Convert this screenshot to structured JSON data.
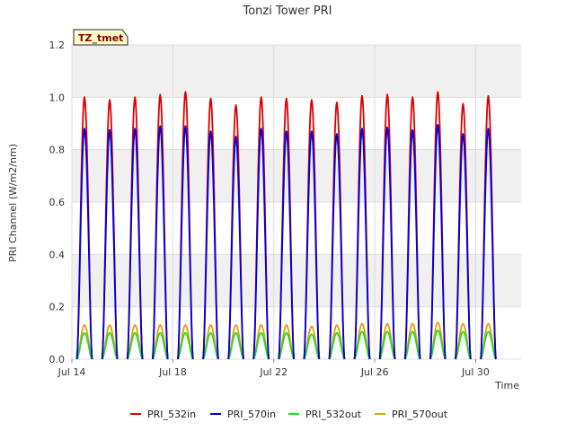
{
  "chart_data": {
    "type": "line",
    "title": "Tonzi Tower PRI",
    "badge": "TZ_tmet",
    "xlabel": "Time",
    "ylabel": "PRI Channel (W/m2/nm)",
    "x_ticks": [
      "Jul 14",
      "Jul 18",
      "Jul 22",
      "Jul 26",
      "Jul 30"
    ],
    "x_tick_days": [
      14,
      18,
      22,
      26,
      30
    ],
    "xlim": [
      14,
      31.8
    ],
    "ylim": [
      0,
      1.2
    ],
    "y_ticks": [
      "0.0",
      "0.2",
      "0.4",
      "0.6",
      "0.8",
      "1.0",
      "1.2"
    ],
    "y_tick_values": [
      0,
      0.2,
      0.4,
      0.6,
      0.8,
      1.0,
      1.2
    ],
    "grid": true,
    "legend_position": "bottom",
    "peak_time_of_day": 0.5,
    "series": [
      {
        "name": "PRI_532in",
        "color": "#dd0000",
        "days": [
          14.5,
          15.5,
          16.5,
          17.5,
          18.5,
          19.5,
          20.5,
          21.5,
          22.5,
          23.5,
          24.5,
          25.5,
          26.5,
          27.5,
          28.5,
          29.5,
          30.5
        ],
        "peaks": [
          1.0,
          0.99,
          1.0,
          1.01,
          1.02,
          0.995,
          0.97,
          1.0,
          0.995,
          0.99,
          0.98,
          1.005,
          1.01,
          1.0,
          1.02,
          0.975,
          1.005
        ]
      },
      {
        "name": "PRI_570in",
        "color": "#0000dd",
        "days": [
          14.5,
          15.5,
          16.5,
          17.5,
          18.5,
          19.5,
          20.5,
          21.5,
          22.5,
          23.5,
          24.5,
          25.5,
          26.5,
          27.5,
          28.5,
          29.5,
          30.5
        ],
        "peaks": [
          0.88,
          0.875,
          0.88,
          0.89,
          0.89,
          0.87,
          0.85,
          0.88,
          0.87,
          0.87,
          0.86,
          0.88,
          0.885,
          0.875,
          0.895,
          0.86,
          0.88
        ]
      },
      {
        "name": "PRI_532out",
        "color": "#22dd22",
        "days": [
          14.5,
          15.5,
          16.5,
          17.5,
          18.5,
          19.5,
          20.5,
          21.5,
          22.5,
          23.5,
          24.5,
          25.5,
          26.5,
          27.5,
          28.5,
          29.5,
          30.5
        ],
        "peaks": [
          0.1,
          0.1,
          0.1,
          0.1,
          0.1,
          0.1,
          0.1,
          0.1,
          0.1,
          0.095,
          0.1,
          0.105,
          0.105,
          0.105,
          0.11,
          0.105,
          0.105
        ]
      },
      {
        "name": "PRI_570out",
        "color": "#e6a000",
        "days": [
          14.5,
          15.5,
          16.5,
          17.5,
          18.5,
          19.5,
          20.5,
          21.5,
          22.5,
          23.5,
          24.5,
          25.5,
          26.5,
          27.5,
          28.5,
          29.5,
          30.5
        ],
        "peaks": [
          0.13,
          0.13,
          0.13,
          0.13,
          0.13,
          0.13,
          0.13,
          0.13,
          0.13,
          0.125,
          0.13,
          0.135,
          0.135,
          0.135,
          0.14,
          0.135,
          0.135
        ]
      }
    ]
  }
}
